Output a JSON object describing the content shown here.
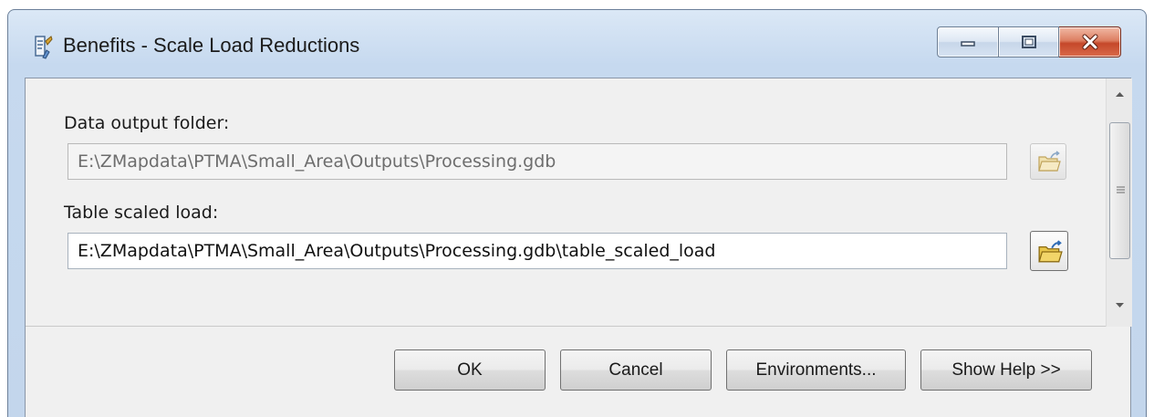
{
  "window": {
    "title": "Benefits - Scale Load Reductions",
    "app_icon": "toolbox-script-icon",
    "controls": [
      "minimize-icon",
      "maximize-icon",
      "close-icon"
    ]
  },
  "form": {
    "data_output_folder": {
      "label": "Data output folder:",
      "value": "E:\\ZMapdata\\PTMA\\Small_Area\\Outputs\\Processing.gdb",
      "browse_icon": "folder-browse-icon",
      "enabled": false
    },
    "table_scaled_load": {
      "label": "Table scaled load:",
      "value": "E:\\ZMapdata\\PTMA\\Small_Area\\Outputs\\Processing.gdb\\table_scaled_load",
      "browse_icon": "folder-browse-icon",
      "enabled": true
    }
  },
  "buttons": {
    "ok": "OK",
    "cancel": "Cancel",
    "environments": "Environments...",
    "show_help": "Show Help >>"
  },
  "colors": {
    "titlebar": "#c6d9ef",
    "client_bg": "#f0f0f0",
    "close_button": "#c5482a"
  }
}
